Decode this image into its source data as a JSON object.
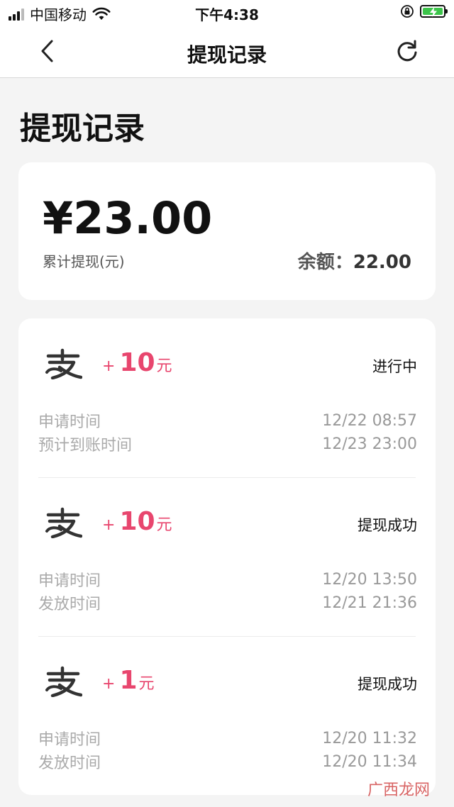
{
  "status_bar": {
    "carrier": "中国移动",
    "time": "下午4:38"
  },
  "nav": {
    "title": "提现记录",
    "back_icon": "chevron-left-icon",
    "refresh_icon": "refresh-icon"
  },
  "page": {
    "title": "提现记录"
  },
  "summary": {
    "total_amount": "¥23.00",
    "total_label": "累计提现(元)",
    "balance_label": "余额：",
    "balance_value": "22.00"
  },
  "records": [
    {
      "method_icon": "alipay-icon",
      "plus": "+",
      "amount": "10",
      "unit": "元",
      "status": "进行中",
      "details": [
        {
          "label": "申请时间",
          "value": "12/22 08:57"
        },
        {
          "label": "预计到账时间",
          "value": "12/23 23:00"
        }
      ]
    },
    {
      "method_icon": "alipay-icon",
      "plus": "+",
      "amount": "10",
      "unit": "元",
      "status": "提现成功",
      "details": [
        {
          "label": "申请时间",
          "value": "12/20 13:50"
        },
        {
          "label": "发放时间",
          "value": "12/21 21:36"
        }
      ]
    },
    {
      "method_icon": "alipay-icon",
      "plus": "+",
      "amount": "1",
      "unit": "元",
      "status": "提现成功",
      "details": [
        {
          "label": "申请时间",
          "value": "12/20 11:32"
        },
        {
          "label": "发放时间",
          "value": "12/20 11:34"
        }
      ]
    }
  ],
  "watermark": "广西龙网",
  "colors": {
    "accent": "#e8466e",
    "background": "#f4f4f4",
    "card": "#ffffff",
    "battery": "#3cc44a"
  }
}
